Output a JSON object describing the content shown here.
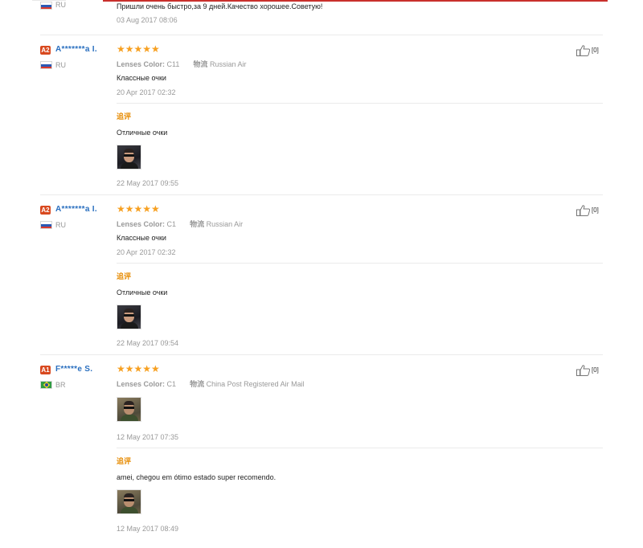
{
  "fragment": {
    "country": "RU",
    "text": "Пришли очень быстро,за 9 дней.Качество хорошее.Советую!",
    "date": "03 Aug 2017 08:06"
  },
  "reviews": [
    {
      "badge": "A2",
      "name": "A*******a I.",
      "country": "RU",
      "stars": "★★★★★",
      "color_label": "Lenses Color:",
      "color_value": "C11",
      "logistics_label": "物流",
      "logistics_value": "Russian Air",
      "text": "Классные очки",
      "date": "20 Apr 2017 02:32",
      "addl_label": "追评",
      "addl_text": "Отличные очки",
      "addl_date": "22 May 2017 09:55",
      "likes": "[0]"
    },
    {
      "badge": "A2",
      "name": "A*******a I.",
      "country": "RU",
      "stars": "★★★★★",
      "color_label": "Lenses Color:",
      "color_value": "C1",
      "logistics_label": "物流",
      "logistics_value": "Russian Air",
      "text": "Классные очки",
      "date": "20 Apr 2017 02:32",
      "addl_label": "追评",
      "addl_text": "Отличные очки",
      "addl_date": "22 May 2017 09:54",
      "likes": "[0]"
    },
    {
      "badge": "A1",
      "name": "F*****e S.",
      "country": "BR",
      "stars": "★★★★★",
      "color_label": "Lenses Color:",
      "color_value": "C1",
      "logistics_label": "物流",
      "logistics_value": "China Post Registered Air Mail",
      "date": "12 May 2017 07:35",
      "addl_label": "追评",
      "addl_text": "amei, chegou em ótimo estado super recomendo.",
      "addl_date": "12 May 2017 08:49",
      "likes": "[0]"
    }
  ],
  "colors": {
    "name_blue": "#2a6fbf",
    "star_orange": "#f7a021",
    "badge_red": "#d8491f",
    "addl_orange": "#e68a00",
    "date_grey": "#999999"
  },
  "icons": {
    "like": "thumbs-up-icon",
    "flag_ru": "russia-flag-icon",
    "flag_br": "brazil-flag-icon"
  }
}
